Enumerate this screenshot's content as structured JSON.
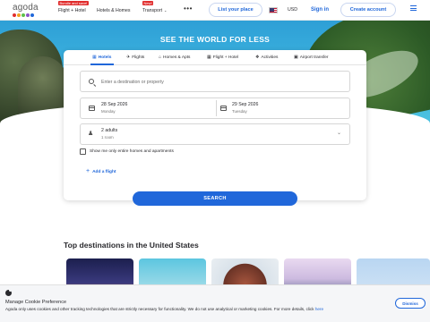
{
  "header": {
    "logo_text": "agoda",
    "logo_colors": [
      "#e12d2d",
      "#f2a01e",
      "#5fbf4a",
      "#8d54c8",
      "#2067da"
    ],
    "nav": [
      {
        "label": "Flight + Hotel",
        "badge": "Bundle and save!"
      },
      {
        "label": "Hotels & Homes",
        "badge": ""
      },
      {
        "label": "Transport",
        "badge": "New!"
      }
    ],
    "more_label": "•••",
    "list_property": "List your place",
    "currency": "USD",
    "sign_in": "Sign in",
    "create_account": "Create account"
  },
  "hero": {
    "title": "SEE THE WORLD FOR LESS"
  },
  "search": {
    "tabs": [
      {
        "label": "Hotels",
        "icon": "building-icon",
        "active": true
      },
      {
        "label": "Flights",
        "icon": "plane-icon",
        "active": false
      },
      {
        "label": "Homes & Apts",
        "icon": "home-icon",
        "active": false
      },
      {
        "label": "Flight + Hotel",
        "icon": "plane-hotel-icon",
        "active": false
      },
      {
        "label": "Activities",
        "icon": "activity-icon",
        "active": false
      },
      {
        "label": "Airport transfer",
        "icon": "car-icon",
        "active": false
      }
    ],
    "destination_placeholder": "Enter a destination or property",
    "checkin_date": "28 Sep 2026",
    "checkin_day": "Monday",
    "checkout_date": "29 Sep 2026",
    "checkout_day": "Tuesday",
    "guests": "2 adults",
    "rooms": "1 room",
    "homes_only_label": "Show me only entire homes and apartments",
    "add_flight_label": "Add a flight",
    "search_button": "SEARCH"
  },
  "destinations": {
    "title": "Top destinations in the United States"
  },
  "cookie": {
    "title": "Manage Cookie Preference",
    "text": "Agoda only uses cookies and other tracking technologies that are strictly necessary for functionality. We do not use analytical or marketing cookies. For more details, click",
    "link": "here",
    "dismiss": "Dismiss"
  },
  "colors": {
    "accent": "#2067da"
  }
}
